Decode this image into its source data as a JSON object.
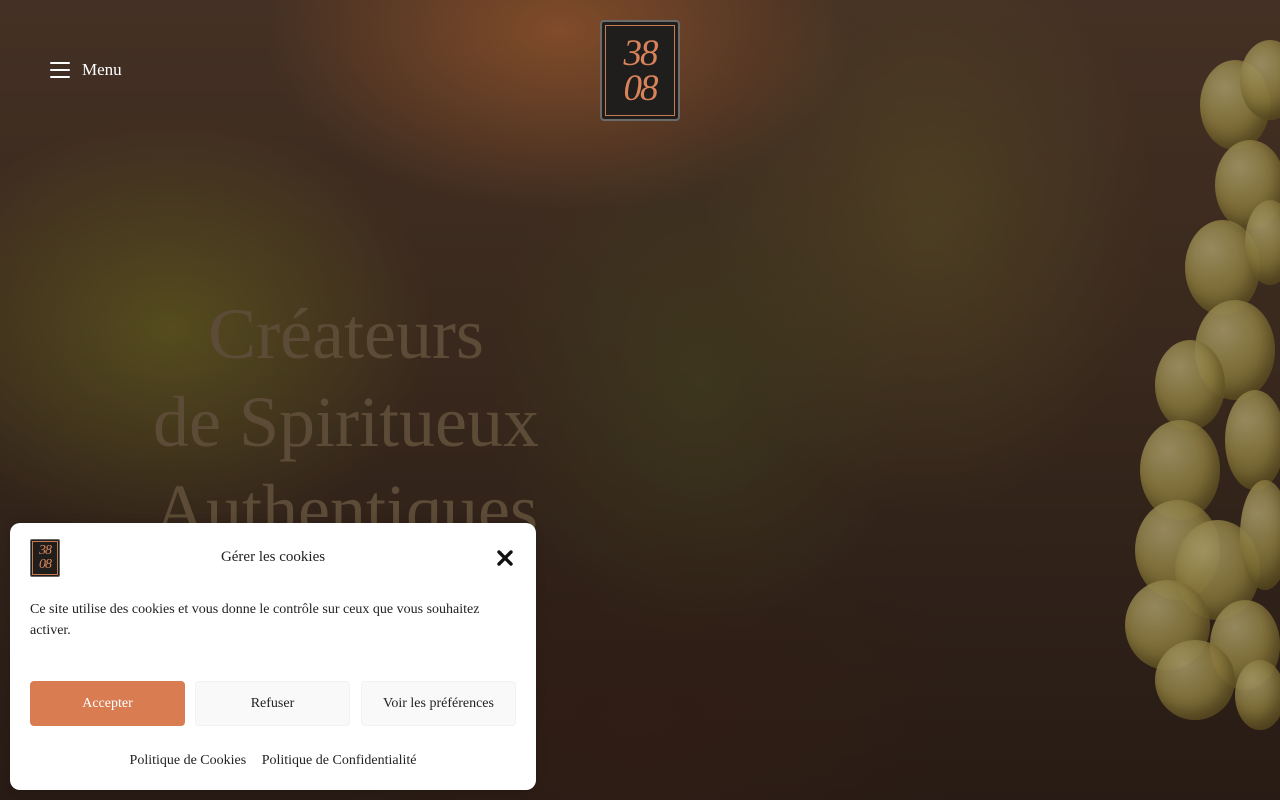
{
  "header": {
    "menu_label": "Menu",
    "logo_top": "38",
    "logo_bottom": "08"
  },
  "hero": {
    "headline_line1": "Créateurs",
    "headline_line2": "de Spiritueux",
    "headline_line3": "Authentiques"
  },
  "cookie_banner": {
    "logo_top": "38",
    "logo_bottom": "08",
    "title": "Gérer les cookies",
    "text": "Ce site utilise des cookies et vous donne le contrôle sur ceux que vous souhaitez activer.",
    "accept_label": "Accepter",
    "deny_label": "Refuser",
    "prefs_label": "Voir les préférences",
    "link_cookies": "Politique de Cookies",
    "link_privacy": "Politique de Confidentialité"
  },
  "colors": {
    "accent": "#d97c52",
    "headline": "#5c4b36"
  }
}
